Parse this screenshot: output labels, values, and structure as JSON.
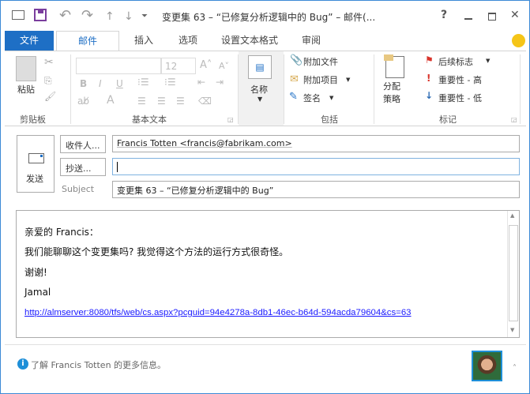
{
  "window": {
    "title": "变更集 63 – “已修复分析逻辑中的 Bug” – 邮件(...",
    "help": "?",
    "minimize": "–",
    "maximize": "□",
    "close": "✕"
  },
  "quick_access": {
    "undo": "↶",
    "redo": "↷",
    "up": "↑",
    "down": "↓",
    "more": "⏷"
  },
  "tabs": [
    "文件",
    "邮件",
    "插入",
    "选项",
    "设置文本格式",
    "审阅"
  ],
  "ribbon": {
    "clipboard": {
      "paste": "粘贴",
      "label": "剪贴板"
    },
    "basic_text": {
      "font_size": "12",
      "bold": "B",
      "italic": "I",
      "underline": "U",
      "label": "基本文本"
    },
    "names": {
      "label": "名称"
    },
    "include": {
      "attach_file": "附加文件",
      "attach_item": "附加项目",
      "signature": "签名",
      "label": "包括"
    },
    "tags": {
      "assign_policy": "分配策略",
      "follow_up": "后续标志",
      "high_importance": "重要性 - 高",
      "low_importance": "重要性 - 低",
      "label": "标记"
    }
  },
  "compose": {
    "send": "发送",
    "to_button": "收件人...",
    "cc_button": "抄送...",
    "subject_label": "Subject",
    "to_value": "Francis Totten <francis@fabrikam.com>",
    "cc_value": "",
    "subject_value": "变更集 63 – “已修复分析逻辑中的 Bug”"
  },
  "body": {
    "greeting": "亲爱的 Francis：",
    "line1": "我们能聊聊这个变更集吗? 我觉得这个方法的运行方式很奇怪。",
    "thanks": "谢谢!",
    "signature": "Jamal",
    "link": "http://almserver:8080/tfs/web/cs.aspx?pcguid=94e4278a-8db1-46ec-b64d-594acda79604&cs=63"
  },
  "footer": {
    "info": "了解 Francis Totten 的更多信息。"
  }
}
